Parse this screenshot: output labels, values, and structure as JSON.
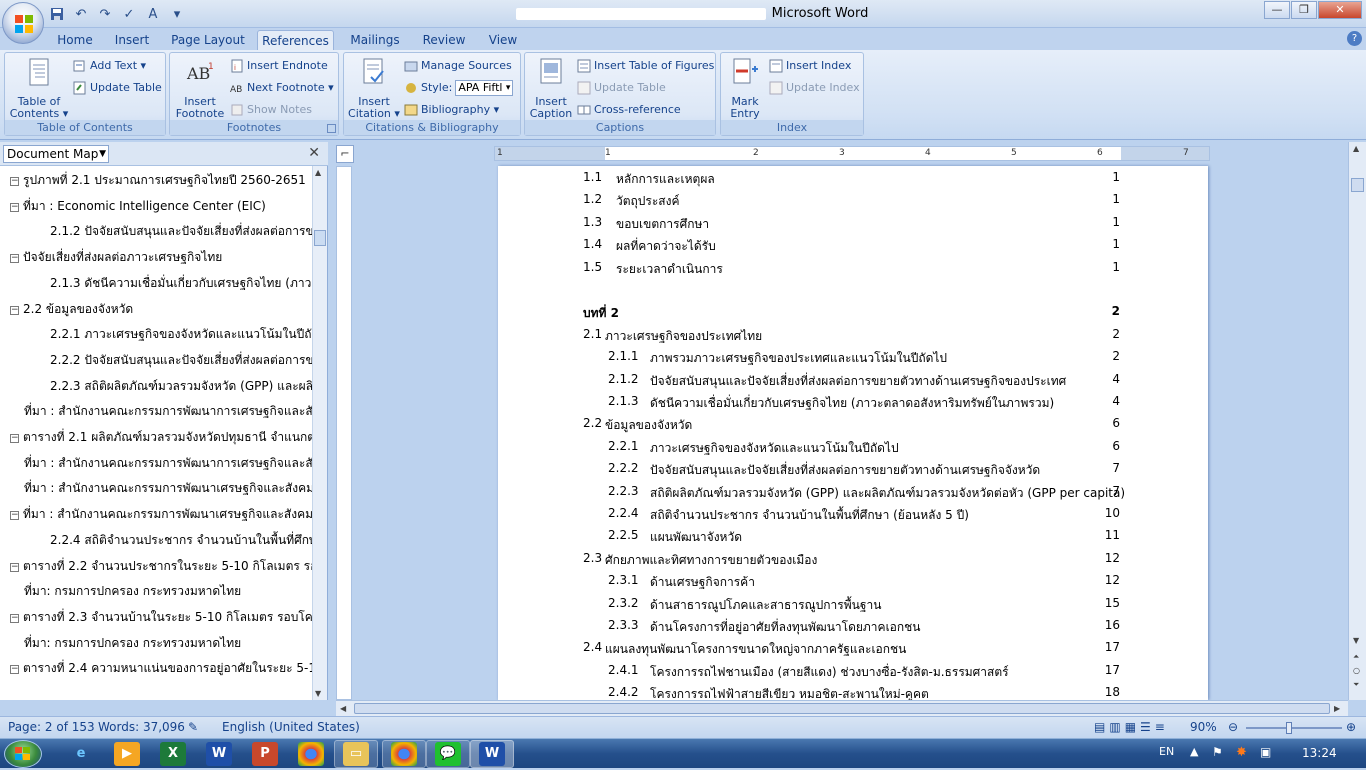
{
  "window": {
    "title_suffix": "Microsoft Word",
    "minimize": "—",
    "restore": "❐",
    "close": "✕"
  },
  "qat": {
    "save": "save-icon",
    "undo": "↶",
    "redo": "↷",
    "check": "✓",
    "format": "A"
  },
  "tabs": [
    {
      "label": "Home"
    },
    {
      "label": "Insert"
    },
    {
      "label": "Page Layout"
    },
    {
      "label": "References",
      "active": true
    },
    {
      "label": "Mailings"
    },
    {
      "label": "Review"
    },
    {
      "label": "View"
    }
  ],
  "help": "?",
  "ribbon": {
    "toc": {
      "big_label1": "Table of",
      "big_label2": "Contents ▾",
      "add_text": "Add Text ▾",
      "update_table": "Update Table",
      "group": "Table of Contents"
    },
    "footnotes": {
      "insert_footnote1": "Insert",
      "insert_footnote2": "Footnote",
      "insert_endnote": "Insert Endnote",
      "next_footnote": "Next Footnote ▾",
      "show_notes": "Show Notes",
      "group": "Footnotes"
    },
    "citations": {
      "insert_citation1": "Insert",
      "insert_citation2": "Citation ▾",
      "manage_sources": "Manage Sources",
      "style_label": "Style:",
      "style_value": "APA Fiftl",
      "bibliography": "Bibliography ▾",
      "group": "Citations & Bibliography"
    },
    "captions": {
      "insert_caption1": "Insert",
      "insert_caption2": "Caption",
      "insert_tof": "Insert Table of Figures",
      "update_table": "Update Table",
      "cross_ref": "Cross-reference",
      "group": "Captions"
    },
    "index": {
      "mark_entry1": "Mark",
      "mark_entry2": "Entry",
      "insert_index": "Insert Index",
      "update_index": "Update Index",
      "group": "Index"
    }
  },
  "docmap": {
    "selector": "Document Map",
    "close": "✕",
    "items": [
      {
        "text": "รูปภาพที่ 2.1 ประมาณการเศรษฐกิจไทยปี 2560-2651",
        "toggle": true,
        "indent": 0
      },
      {
        "text": "ที่มา : Economic Intelligence Center (EIC)",
        "toggle": true,
        "indent": 0
      },
      {
        "text": "2.1.2 ปัจจัยสนับสนุนและปัจจัยเสี่ยงที่ส่งผลต่อการขยายตัว",
        "toggle": false,
        "indent": 1
      },
      {
        "text": "ปัจจัยเสี่ยงที่ส่งผลต่อภาวะเศรษฐกิจไทย",
        "toggle": true,
        "indent": 0
      },
      {
        "text": "2.1.3 ดัชนีความเชื่อมั่นเกี่ยวกับเศรษฐกิจไทย (ภาวะตลาด",
        "toggle": false,
        "indent": 1
      },
      {
        "text": "2.2 ข้อมูลของจังหวัด",
        "toggle": true,
        "indent": 0
      },
      {
        "text": "2.2.1 ภาวะเศรษฐกิจของจังหวัดและแนวโน้มในปีถัดไป",
        "toggle": false,
        "indent": 1
      },
      {
        "text": "2.2.2 ปัจจัยสนับสนุนและปัจจัยเสี่ยงที่ส่งผลต่อการขยายตัว",
        "toggle": false,
        "indent": 1
      },
      {
        "text": "2.2.3 สถิติผลิตภัณฑ์มวลรวมจังหวัด (GPP) และผลิตภัณฑ์",
        "toggle": false,
        "indent": 1
      },
      {
        "text": "ที่มา : สำนักงานคณะกรรมการพัฒนาการเศรษฐกิจและสังคมแห่งชาติ",
        "toggle": false,
        "indent": 0
      },
      {
        "text": "ตารางที่ 2.1 ผลิตภัณฑ์มวลรวมจังหวัดปทุมธานี จำแนกตามสาขา",
        "toggle": true,
        "indent": 0
      },
      {
        "text": "ที่มา : สำนักงานคณะกรรมการพัฒนาการเศรษฐกิจและสังคม",
        "toggle": false,
        "indent": 0
      },
      {
        "text": "ที่มา : สำนักงานคณะกรรมการพัฒนาเศรษฐกิจและสังคมแห่งชาติ",
        "toggle": false,
        "indent": 0
      },
      {
        "text": "ที่มา : สำนักงานคณะกรรมการพัฒนาเศรษฐกิจและสังคมแห่งชาติ",
        "toggle": true,
        "indent": 0
      },
      {
        "text": "2.2.4 สถิติจำนวนประชากร จำนวนบ้านในพื้นที่ศึกษา",
        "toggle": false,
        "indent": 1
      },
      {
        "text": "ตารางที่ 2.2 จำนวนประชากรในระยะ 5-10 กิโลเมตร รอบโครงการ",
        "toggle": true,
        "indent": 0
      },
      {
        "text": "ที่มา: กรมการปกครอง กระทรวงมหาดไทย",
        "toggle": false,
        "indent": 0
      },
      {
        "text": "ตารางที่ 2.3 จำนวนบ้านในระยะ 5-10 กิโลเมตร รอบโครงการ",
        "toggle": true,
        "indent": 0
      },
      {
        "text": "ที่มา: กรมการปกครอง กระทรวงมหาดไทย",
        "toggle": false,
        "indent": 0
      },
      {
        "text": "ตารางที่ 2.4 ความหนาแน่นของการอยู่อาศัยในระยะ 5-10 กิโลเมตร",
        "toggle": true,
        "indent": 0
      }
    ]
  },
  "ruler_numbers": [
    "1",
    "1",
    "2",
    "3",
    "4",
    "5",
    "6",
    "7"
  ],
  "toc": [
    {
      "num": "1.1",
      "text": "หลักการและเหตุผล",
      "page": "1",
      "level": 1
    },
    {
      "num": "1.2",
      "text": "วัตถุประสงค์",
      "page": "1",
      "level": 1
    },
    {
      "num": "1.3",
      "text": "ขอบเขตการศึกษา",
      "page": "1",
      "level": 1
    },
    {
      "num": "1.4",
      "text": "ผลที่คาดว่าจะได้รับ",
      "page": "1",
      "level": 1
    },
    {
      "num": "1.5",
      "text": "ระยะเวลาดำเนินการ",
      "page": "1",
      "level": 1
    },
    {
      "num": "",
      "text": "",
      "page": "",
      "level": 0
    },
    {
      "num": "บทที่ 2",
      "text": "",
      "page": "2",
      "level": 0,
      "bold": true
    },
    {
      "num": "2.1",
      "text": "ภาวะเศรษฐกิจของประเทศไทย",
      "page": "2",
      "level": 0
    },
    {
      "num": "2.1.1",
      "text": "ภาพรวมภาวะเศรษฐกิจของประเทศและแนวโน้มในปีถัดไป",
      "page": "2",
      "level": 2
    },
    {
      "num": "2.1.2",
      "text": "ปัจจัยสนับสนุนและปัจจัยเสี่ยงที่ส่งผลต่อการขยายตัวทางด้านเศรษฐกิจของประเทศ",
      "page": "4",
      "level": 2
    },
    {
      "num": "2.1.3",
      "text": "ดัชนีความเชื่อมั่นเกี่ยวกับเศรษฐกิจไทย (ภาวะตลาดอสังหาริมทรัพย์ในภาพรวม)",
      "page": "4",
      "level": 2
    },
    {
      "num": "2.2",
      "text": "ข้อมูลของจังหวัด",
      "page": "6",
      "level": 0
    },
    {
      "num": "2.2.1",
      "text": "ภาวะเศรษฐกิจของจังหวัดและแนวโน้มในปีถัดไป",
      "page": "6",
      "level": 2
    },
    {
      "num": "2.2.2",
      "text": "ปัจจัยสนับสนุนและปัจจัยเสี่ยงที่ส่งผลต่อการขยายตัวทางด้านเศรษฐกิจจังหวัด",
      "page": "7",
      "level": 2
    },
    {
      "num": "2.2.3",
      "text": "สถิติผลิตภัณฑ์มวลรวมจังหวัด (GPP) และผลิตภัณฑ์มวลรวมจังหวัดต่อหัว (GPP per capita)",
      "page": "7",
      "level": 2
    },
    {
      "num": "2.2.4",
      "text": "สถิติจำนวนประชากร จำนวนบ้านในพื้นที่ศึกษา (ย้อนหลัง 5 ปี)",
      "page": "10",
      "level": 2
    },
    {
      "num": "2.2.5",
      "text": "แผนพัฒนาจังหวัด",
      "page": "11",
      "level": 2
    },
    {
      "num": "2.3",
      "text": "ศักยภาพและทิศทางการขยายตัวของเมือง",
      "page": "12",
      "level": 0
    },
    {
      "num": "2.3.1",
      "text": "ด้านเศรษฐกิจการค้า",
      "page": "12",
      "level": 2
    },
    {
      "num": "2.3.2",
      "text": "ด้านสาธารณูปโภคและสาธารณูปการพื้นฐาน",
      "page": "15",
      "level": 2
    },
    {
      "num": "2.3.3",
      "text": "ด้านโครงการที่อยู่อาศัยที่ลงทุนพัฒนาโดยภาคเอกชน",
      "page": "16",
      "level": 2
    },
    {
      "num": "2.4",
      "text": "แผนลงทุนพัฒนาโครงการขนาดใหญ่จากภาครัฐและเอกชน",
      "page": "17",
      "level": 0
    },
    {
      "num": "2.4.1",
      "text": "โครงการรถไฟชานเมือง (สายสีแดง) ช่วงบางซื่อ-รังสิต-ม.ธรรมศาสตร์",
      "page": "17",
      "level": 2
    },
    {
      "num": "2.4.2",
      "text": "โครงการรถไฟฟ้าสายสีเขียว หมอชิต-สะพานใหม่-คูคต",
      "page": "18",
      "level": 2
    }
  ],
  "status": {
    "page": "Page: 2 of 153",
    "words": "Words: 37,096",
    "language": "English (United States)",
    "zoom": "90%",
    "zoom_level": 0.9
  },
  "taskbar": {
    "lang": "EN",
    "time": "13:24"
  }
}
